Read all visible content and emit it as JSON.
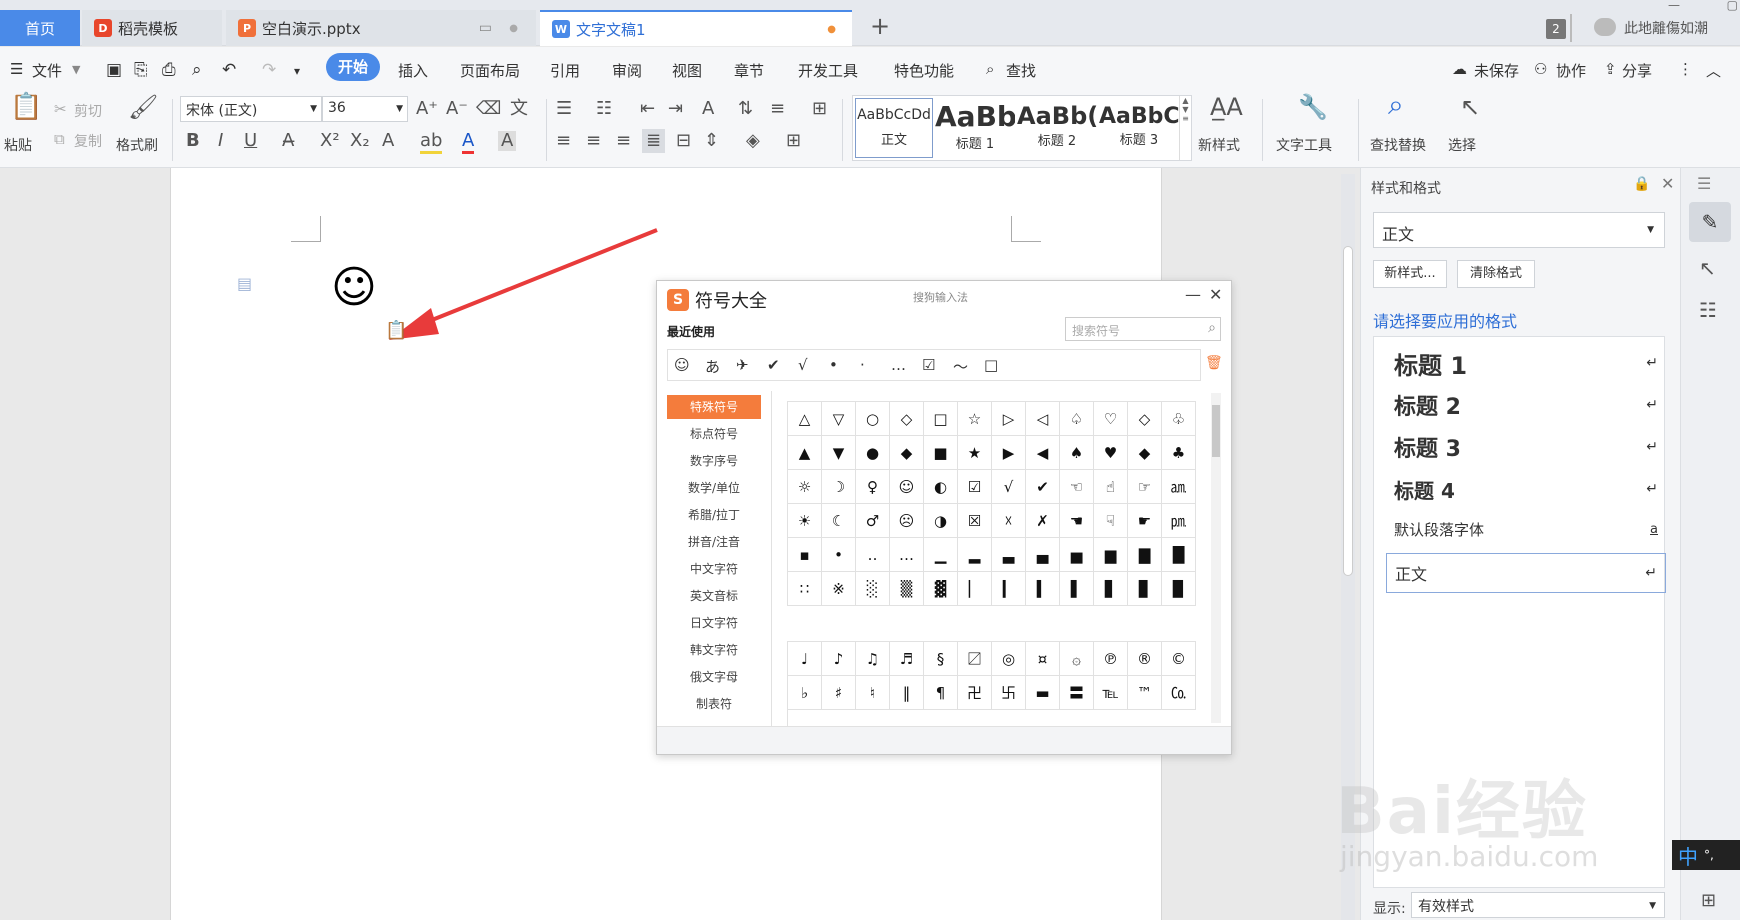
{
  "tabs": [
    {
      "label": "首页"
    },
    {
      "label": "稻壳模板"
    },
    {
      "label": "空白演示.pptx"
    },
    {
      "label": "文字文稿1"
    }
  ],
  "tab_count": "2",
  "user_name": "此地離傷如潮",
  "menu": {
    "file": "文件",
    "items": [
      "开始",
      "插入",
      "页面布局",
      "引用",
      "审阅",
      "视图",
      "章节",
      "开发工具",
      "特色功能"
    ],
    "search": "查找",
    "unsaved": "未保存",
    "collab": "协作",
    "share": "分享"
  },
  "ribbon": {
    "paste": "粘贴",
    "cut": "剪切",
    "copy": "复制",
    "format_painter": "格式刷",
    "font_name": "宋体 (正文)",
    "font_size": "36",
    "styles": [
      {
        "preview": "AaBbCcDd",
        "label": "正文"
      },
      {
        "preview": "AaBb",
        "label": "标题 1"
      },
      {
        "preview": "AaBb(",
        "label": "标题 2"
      },
      {
        "preview": "AaBbC(",
        "label": "标题 3"
      }
    ],
    "new_style": "新样式",
    "text_tools": "文字工具",
    "find_replace": "查找替换",
    "select": "选择"
  },
  "document": {
    "symbol": "☺"
  },
  "symbol_dialog": {
    "title": "符号大全",
    "subtitle": "搜狗输入法",
    "recent_label": "最近使用",
    "search_placeholder": "搜索符号",
    "recent": [
      "☺",
      "あ",
      "✈",
      "✔",
      "√",
      "•",
      "·",
      "…",
      "☑",
      "～",
      "□"
    ],
    "categories": [
      "特殊符号",
      "标点符号",
      "数字序号",
      "数学/单位",
      "希腊/拉丁",
      "拼音/注音",
      "中文字符",
      "英文音标",
      "日文字符",
      "韩文字符",
      "俄文字母",
      "制表符"
    ],
    "grid": [
      [
        "△",
        "▽",
        "○",
        "◇",
        "□",
        "☆",
        "▷",
        "◁",
        "♤",
        "♡",
        "◇",
        "♧"
      ],
      [
        "▲",
        "▼",
        "●",
        "◆",
        "■",
        "★",
        "▶",
        "◀",
        "♠",
        "♥",
        "◆",
        "♣"
      ],
      [
        "☼",
        "☽",
        "♀",
        "☺",
        "◐",
        "☑",
        "√",
        "✔",
        "☜",
        "☝",
        "☞",
        "㏂"
      ],
      [
        "☀",
        "☾",
        "♂",
        "☹",
        "◑",
        "☒",
        "☓",
        "✗",
        "☚",
        "☟",
        "☛",
        "㏘"
      ],
      [
        "▪",
        "•",
        "‥",
        "…",
        "▁",
        "▂",
        "▃",
        "▄",
        "▅",
        "▆",
        "▇",
        "█"
      ],
      [
        "∷",
        "※",
        "░",
        "▒",
        "▓",
        "▏",
        "▎",
        "▍",
        "▌",
        "▋",
        "▊",
        "▉"
      ]
    ],
    "grid2": [
      [
        "♩",
        "♪",
        "♫",
        "♬",
        "§",
        "〼",
        "◎",
        "¤",
        "۞",
        "℗",
        "®",
        "©"
      ],
      [
        "♭",
        "♯",
        "♮",
        "‖",
        "¶",
        "卍",
        "卐",
        "▬",
        "〓",
        "℡",
        "™",
        "㏇"
      ]
    ]
  },
  "panel": {
    "title": "样式和格式",
    "current_style": "正文",
    "new_style_btn": "新样式...",
    "clear_btn": "清除格式",
    "choose_label": "请选择要应用的格式",
    "items": [
      {
        "label": "标题 1",
        "mark": "↵"
      },
      {
        "label": "标题 2",
        "mark": "↵"
      },
      {
        "label": "标题 3",
        "mark": "↵"
      },
      {
        "label": "标题 4",
        "mark": "↵"
      },
      {
        "label": "默认段落字体",
        "mark": "a"
      },
      {
        "label": "正文",
        "mark": "↵"
      }
    ],
    "show_label": "显示:",
    "show_value": "有效样式"
  },
  "ime": {
    "label": "中"
  },
  "watermark": {
    "brand": "Bai经验",
    "url": "jingyan.baidu.com"
  },
  "colors": {
    "accent": "#2f6fd6",
    "tab_active": "#4a8ae8",
    "dialog_accent": "#f47c3c",
    "arrow": "#e83b3b"
  }
}
